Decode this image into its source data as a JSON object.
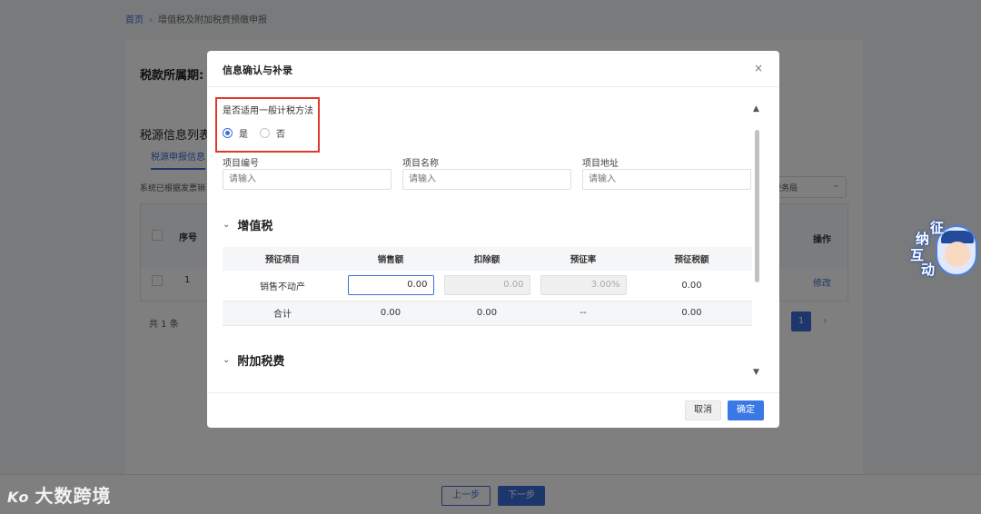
{
  "breadcrumb": {
    "home": "首页",
    "separator": "›",
    "current": "增值税及附加税费预缴申报"
  },
  "background": {
    "period_label": "税款所属期:",
    "list_title": "税源信息列表",
    "tab_label": "税源申报信息",
    "note_text": "系统已根据发票销",
    "select_value": "税务局",
    "table_seq_header": "序号",
    "table_seq_value": "1",
    "table_op_header": "操作",
    "table_op_value": "修改",
    "total_text": "共 1 条",
    "page_number": "1",
    "prev_button": "上一步",
    "next_button": "下一步"
  },
  "modal": {
    "title": "信息确认与补录",
    "close_glyph": "×",
    "method_label": "是否适用一般计税方法",
    "radio_yes": "是",
    "radio_no": "否",
    "selected_option": "是",
    "fields": [
      {
        "label": "项目编号",
        "placeholder": "请输入"
      },
      {
        "label": "项目名称",
        "placeholder": "请输入"
      },
      {
        "label": "项目地址",
        "placeholder": "请输入"
      }
    ],
    "vat_section_title": "增值税",
    "vat_headers": [
      "预征项目",
      "销售额",
      "扣除额",
      "预征率",
      "预征税额"
    ],
    "vat_row": {
      "item": "销售不动产",
      "sales": "0.00",
      "deduction": "0.00",
      "rate": "3.00%",
      "tax": "0.00"
    },
    "vat_total": {
      "label": "合计",
      "sales": "0.00",
      "deduction": "0.00",
      "rate": "--",
      "tax": "0.00"
    },
    "surcharge_section_title": "附加税费",
    "cancel_button": "取消",
    "confirm_button": "确定"
  },
  "widget": {
    "chars": [
      "征",
      "纳",
      "互",
      "动"
    ]
  },
  "watermark": {
    "logo": "Ko",
    "text": "大数跨境"
  },
  "colors": {
    "accent": "#3a6fd8",
    "highlight_border": "#e0382b",
    "confirm": "#3a78e6"
  }
}
